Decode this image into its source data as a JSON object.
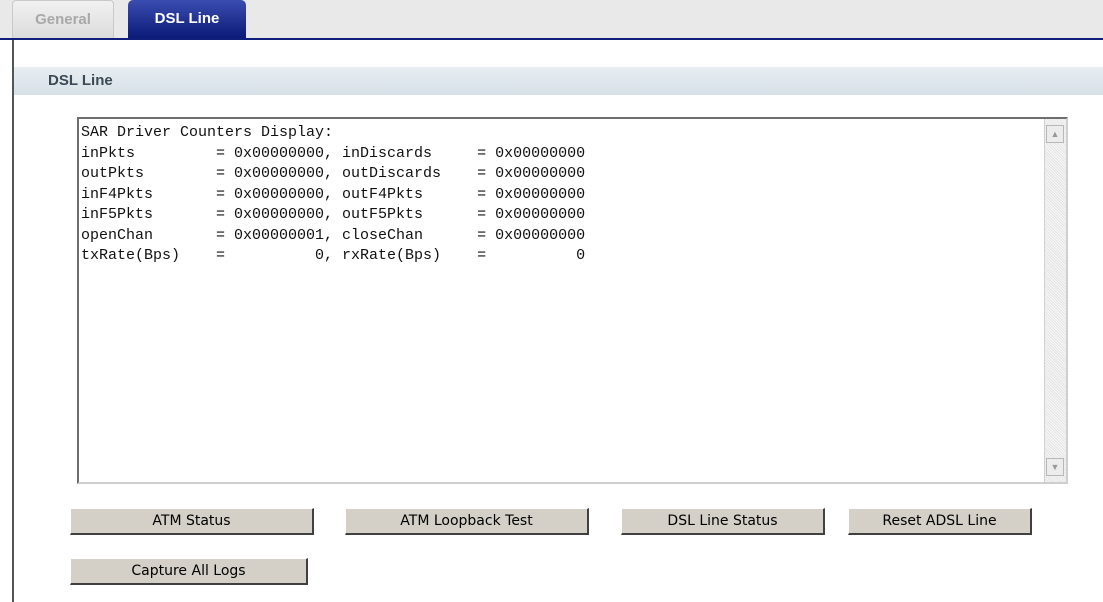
{
  "tabs": [
    {
      "label": "General",
      "active": false
    },
    {
      "label": "DSL Line",
      "active": true
    }
  ],
  "section": {
    "title": "DSL Line"
  },
  "log": {
    "lines": [
      "SAR Driver Counters Display:",
      "inPkts         = 0x00000000, inDiscards     = 0x00000000",
      "outPkts        = 0x00000000, outDiscards    = 0x00000000",
      "inF4Pkts       = 0x00000000, outF4Pkts      = 0x00000000",
      "inF5Pkts       = 0x00000000, outF5Pkts      = 0x00000000",
      "openChan       = 0x00000001, closeChan      = 0x00000000",
      "txRate(Bps)    =          0, rxRate(Bps)    =          0"
    ]
  },
  "buttons": {
    "atm_status": "ATM Status",
    "atm_loopback": "ATM Loopback Test",
    "dsl_line_status": "DSL Line Status",
    "reset_adsl": "Reset ADSL Line",
    "capture_logs": "Capture All Logs"
  },
  "colors": {
    "active_tab": "#0c1a78",
    "section_header_bg": "#dce6eb",
    "button_face": "#d4d0c8"
  },
  "icons": {
    "scroll_up": "▲",
    "scroll_down": "▼"
  }
}
